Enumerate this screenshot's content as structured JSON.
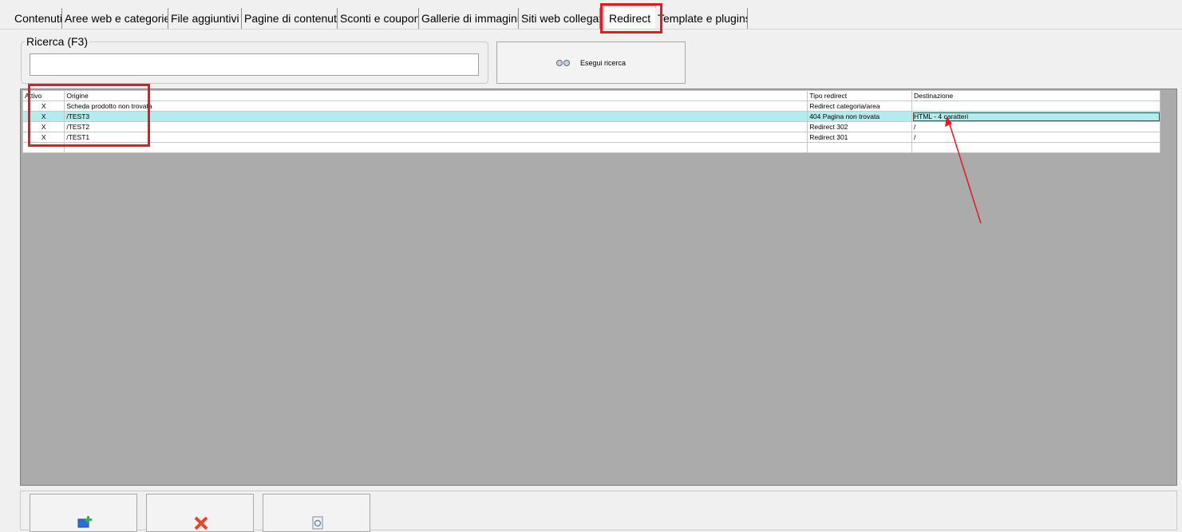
{
  "tabs": [
    {
      "label": "Contenuti"
    },
    {
      "label": "Aree web e categorie"
    },
    {
      "label": "File aggiuntivi"
    },
    {
      "label": "Pagine di contenuti"
    },
    {
      "label": "Sconti e coupon"
    },
    {
      "label": "Gallerie di immagini"
    },
    {
      "label": "Siti web collegati"
    },
    {
      "label": "Redirect"
    },
    {
      "label": "Template e plugins"
    }
  ],
  "search": {
    "legend": "Ricerca (F3)",
    "value": "",
    "button_label": "Esegui ricerca",
    "button_icon": "binoculars-icon"
  },
  "grid": {
    "headers": {
      "attivo": "Attivo",
      "origine": "Origine",
      "tipo": "Tipo redirect",
      "destinazione": "Destinazione"
    },
    "rows": [
      {
        "attivo": "X",
        "origine": "Scheda prodotto non trovata",
        "tipo": "Redirect categoria/area",
        "destinazione": ""
      },
      {
        "attivo": "X",
        "origine": "/TEST3",
        "tipo": "404 Pagina non trovata",
        "destinazione": "HTML - 4 caratteri"
      },
      {
        "attivo": "X",
        "origine": "/TEST2",
        "tipo": "Redirect 302",
        "destinazione": "/"
      },
      {
        "attivo": "X",
        "origine": "/TEST1",
        "tipo": "Redirect 301",
        "destinazione": "/"
      }
    ]
  },
  "bottom_buttons": [
    {
      "icon": "add-icon"
    },
    {
      "icon": "delete-icon"
    },
    {
      "icon": "properties-icon"
    }
  ],
  "colors": {
    "highlight": "#e01b24",
    "selected_row": "#b2ecec",
    "grid_background": "#ababab"
  }
}
